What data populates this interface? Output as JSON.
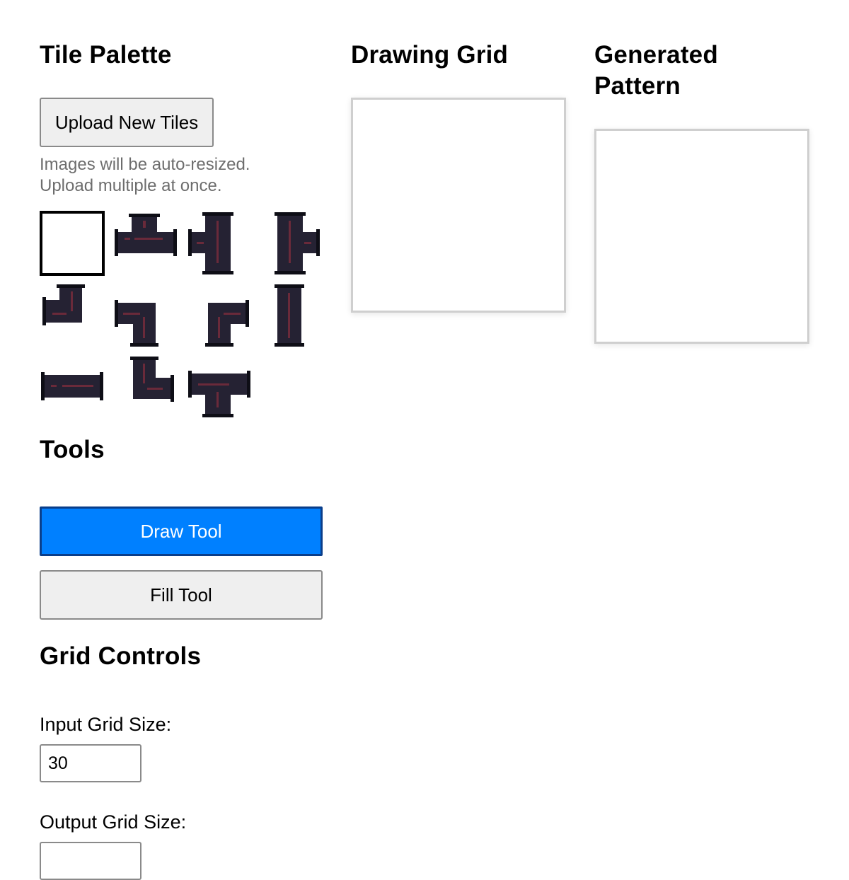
{
  "palette": {
    "title": "Tile Palette",
    "upload_label": "Upload New Tiles",
    "hint_line1": "Images will be auto-resized.",
    "hint_line2": "Upload multiple at once.",
    "tiles": [
      "empty-tile",
      "pipe-tee-up",
      "pipe-tee-left",
      "pipe-tee-right",
      "pipe-elbow-left-up",
      "pipe-elbow-left-down",
      "pipe-elbow-right-down",
      "pipe-straight-vertical",
      "pipe-straight-horizontal",
      "pipe-elbow-up-right",
      "pipe-tee-down"
    ],
    "selected_index": 0,
    "colors": {
      "pipe": "#252233",
      "flange": "#0e0e16",
      "detail": "#6a2a3a"
    }
  },
  "tools": {
    "title": "Tools",
    "draw_label": "Draw Tool",
    "fill_label": "Fill Tool",
    "active": "Draw Tool",
    "active_color": "#0080ff"
  },
  "grid_controls": {
    "title": "Grid Controls",
    "input_label": "Input Grid Size:",
    "input_value": "30",
    "output_label": "Output Grid Size:",
    "output_value": ""
  },
  "drawing": {
    "title": "Drawing Grid"
  },
  "generated": {
    "title_line1": "Generated",
    "title_line2": "Pattern"
  }
}
